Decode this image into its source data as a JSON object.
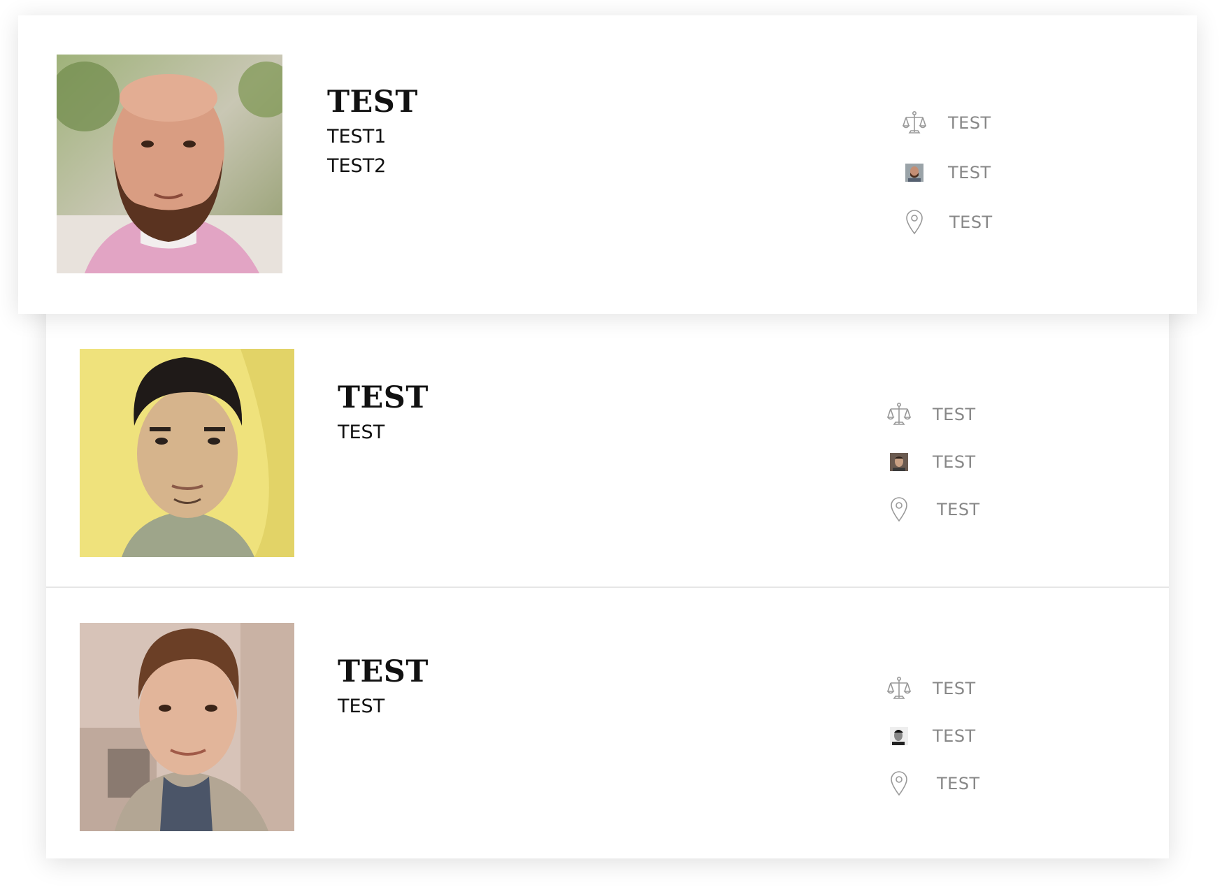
{
  "cards": [
    {
      "name": "TEST",
      "lines": [
        "TEST1",
        "TEST2"
      ],
      "meta": [
        {
          "icon": "scales-icon",
          "text": "TEST"
        },
        {
          "icon": "avatar-icon",
          "text": "TEST"
        },
        {
          "icon": "location-pin-icon",
          "text": "TEST"
        }
      ]
    },
    {
      "name": "TEST",
      "lines": [
        "TEST"
      ],
      "meta": [
        {
          "icon": "scales-icon",
          "text": "TEST"
        },
        {
          "icon": "avatar-icon",
          "text": "TEST"
        },
        {
          "icon": "location-pin-icon",
          "text": "TEST"
        }
      ]
    },
    {
      "name": "TEST",
      "lines": [
        "TEST"
      ],
      "meta": [
        {
          "icon": "scales-icon",
          "text": "TEST"
        },
        {
          "icon": "avatar-icon",
          "text": "TEST"
        },
        {
          "icon": "location-pin-icon",
          "text": "TEST"
        }
      ]
    }
  ],
  "colors": {
    "name_text": "#111111",
    "meta_text": "#888888",
    "icon_stroke": "#999999",
    "divider": "#e6e6e6"
  }
}
